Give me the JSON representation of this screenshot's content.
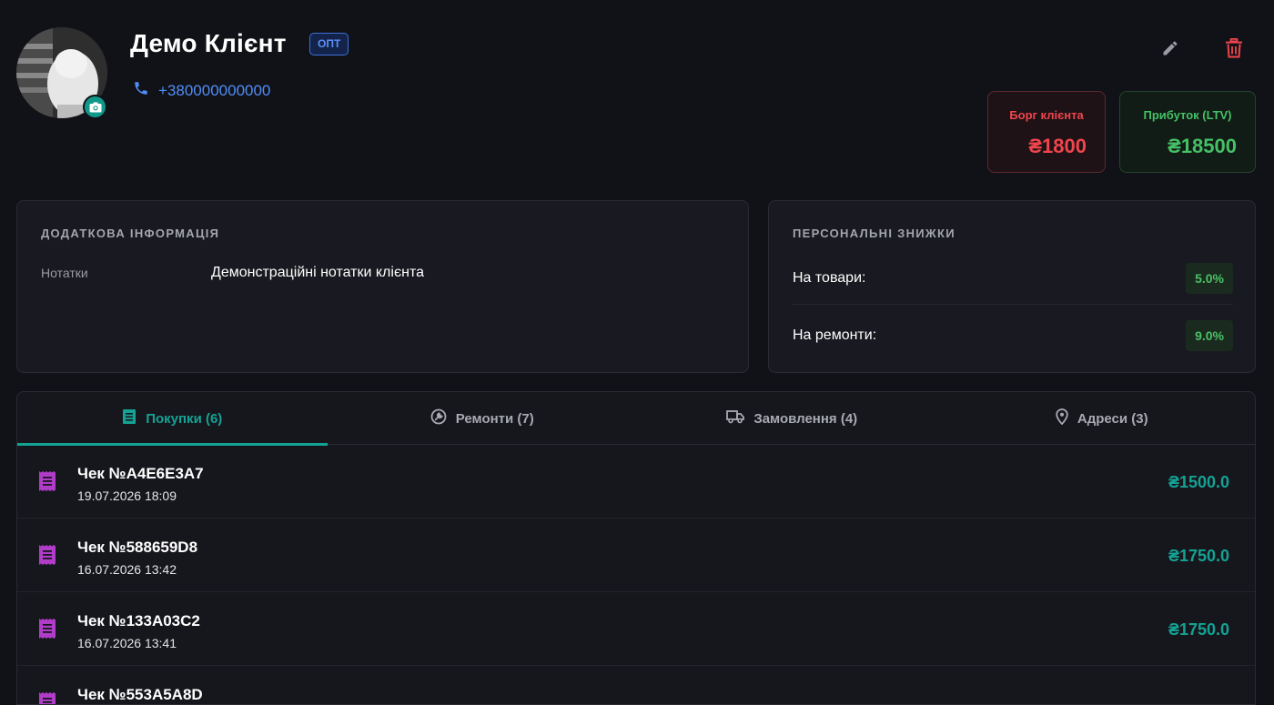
{
  "client": {
    "name": "Демо Клієнт",
    "badge": "ОПТ",
    "phone": "+380000000000"
  },
  "stats": {
    "debt_label": "Борг клієнта",
    "debt_value": "₴1800",
    "ltv_label": "Прибуток (LTV)",
    "ltv_value": "₴18500"
  },
  "info": {
    "title": "ДОДАТКОВА ІНФОРМАЦІЯ",
    "notes_label": "Нотатки",
    "notes_value": "Демонстраційні нотатки клієнта"
  },
  "discounts": {
    "title": "ПЕРСОНАЛЬНІ ЗНИЖКИ",
    "items": [
      {
        "label": "На товари:",
        "value": "5.0%"
      },
      {
        "label": "На ремонти:",
        "value": "9.0%"
      }
    ]
  },
  "tabs": [
    {
      "label": "Покупки (6)",
      "icon": "receipt-icon",
      "active": true
    },
    {
      "label": "Ремонти (7)",
      "icon": "wrench-icon",
      "active": false
    },
    {
      "label": "Замовлення (4)",
      "icon": "truck-icon",
      "active": false
    },
    {
      "label": "Адреси (3)",
      "icon": "location-pin-icon",
      "active": false
    }
  ],
  "purchases": [
    {
      "title": "Чек №A4E6E3A7",
      "date": "19.07.2026 18:09",
      "amount": "₴1500.0"
    },
    {
      "title": "Чек №588659D8",
      "date": "16.07.2026 13:42",
      "amount": "₴1750.0"
    },
    {
      "title": "Чек №133A03C2",
      "date": "16.07.2026 13:41",
      "amount": "₴1750.0"
    },
    {
      "title": "Чек №553A5A8D",
      "date": "",
      "amount": ""
    }
  ],
  "colors": {
    "accent": "#14a294",
    "debt": "#f0454d",
    "profit": "#45c065",
    "phone": "#4f8ef7",
    "receipt_icon": "#b03cc8"
  }
}
